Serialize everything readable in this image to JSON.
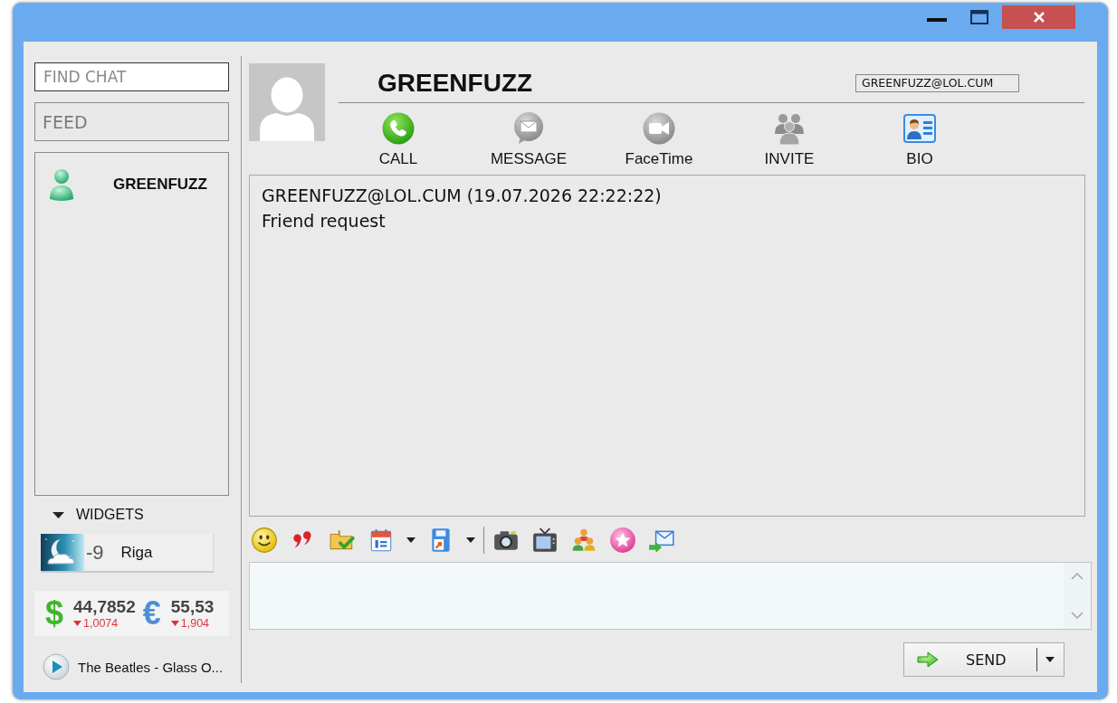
{
  "sidebar": {
    "search": {
      "placeholder": "FIND CHAT"
    },
    "feed": {
      "label": "FEED"
    },
    "contacts": [
      {
        "name": "GREENFUZZ",
        "selected": false
      }
    ],
    "widgets": {
      "label": "WIDGETS",
      "expanded": true,
      "weather": {
        "temperature": "-9",
        "city": "Riga"
      },
      "rates": [
        {
          "kind": "dollar",
          "symbol": "$",
          "rate": "44,7852",
          "falling": true,
          "change": "1,0074"
        },
        {
          "kind": "euro",
          "symbol": "€",
          "rate": "55,53",
          "falling": true,
          "change": "1,904"
        }
      ],
      "player": {
        "track": "The Beatles - Glass O..."
      }
    }
  },
  "chat": {
    "contact": {
      "name": "GREENFUZZ",
      "email": "GREENFUZZ@LOL.CUM"
    },
    "actions": [
      {
        "kind": "call",
        "label": "CALL"
      },
      {
        "kind": "message",
        "label": "MESSAGE"
      },
      {
        "kind": "video",
        "label": "FaceTime"
      },
      {
        "kind": "invite",
        "label": "INVITE"
      },
      {
        "kind": "bio",
        "label": "BIO"
      }
    ],
    "messages": [
      {
        "sender": "GREENFUZZ@LOL.CUM",
        "time": "(19.07.2026 22:22:22)",
        "text": "Friend request"
      }
    ],
    "toolbar": [
      {
        "kind": "smiley",
        "dropdown": false
      },
      {
        "kind": "quote",
        "dropdown": false
      },
      {
        "kind": "folder-check",
        "dropdown": false
      },
      {
        "kind": "calendar",
        "dropdown": true
      },
      {
        "kind": "disk",
        "dropdown": true
      },
      {
        "kind": "separator",
        "dropdown": false
      },
      {
        "kind": "camera",
        "dropdown": false
      },
      {
        "kind": "tv",
        "dropdown": false
      },
      {
        "kind": "people",
        "dropdown": false
      },
      {
        "kind": "star",
        "dropdown": false
      },
      {
        "kind": "mail",
        "dropdown": false
      }
    ],
    "send": {
      "label": "SEND"
    }
  }
}
